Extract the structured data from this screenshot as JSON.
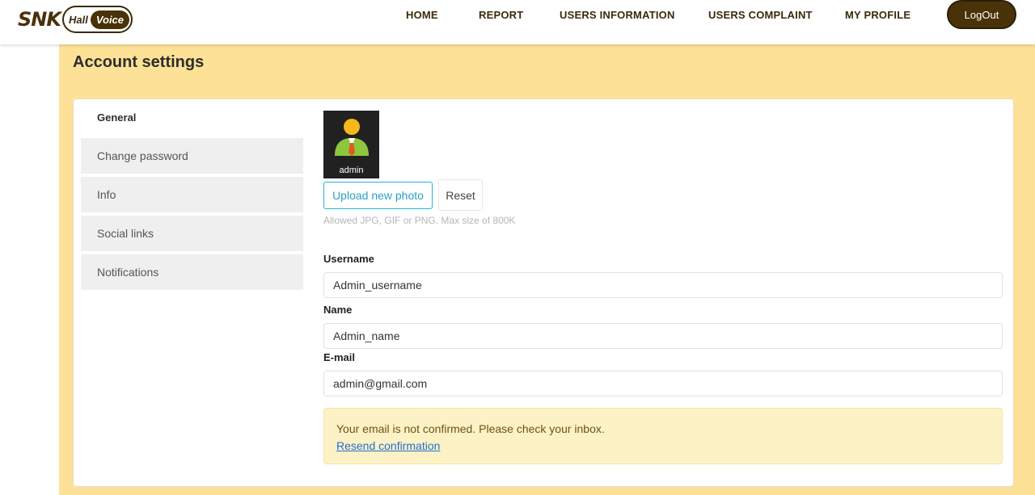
{
  "brand": {
    "snk": "SNK",
    "hall": "Hall",
    "voice": "Voice"
  },
  "nav": {
    "home": "HOME",
    "report": "REPORT",
    "users_information": "USERS INFORMATION",
    "users_complaint": "USERS COMPLAINT",
    "my_profile": "MY PROFILE",
    "logout": "LogOut"
  },
  "page": {
    "title": "Account settings"
  },
  "sidebar": {
    "items": [
      {
        "label": "General"
      },
      {
        "label": "Change password"
      },
      {
        "label": "Info"
      },
      {
        "label": "Social links"
      },
      {
        "label": "Notifications"
      }
    ]
  },
  "profile": {
    "avatar_label": "admin",
    "upload_label": "Upload new photo",
    "reset_label": "Reset",
    "hint": "Allowed JPG, GIF or PNG. Max size of 800K"
  },
  "form": {
    "username_label": "Username",
    "username_value": "Admin_username",
    "name_label": "Name",
    "name_value": "Admin_name",
    "email_label": "E-mail",
    "email_value": "admin@gmail.com"
  },
  "alert": {
    "message": "Your email is not confirmed. Please check your inbox.",
    "link": "Resend confirmation"
  },
  "colors": {
    "accent_brown": "#4a3208",
    "page_yellow": "#fde196",
    "upload_blue": "#26b4d8",
    "alert_bg": "#fdf1c6"
  }
}
